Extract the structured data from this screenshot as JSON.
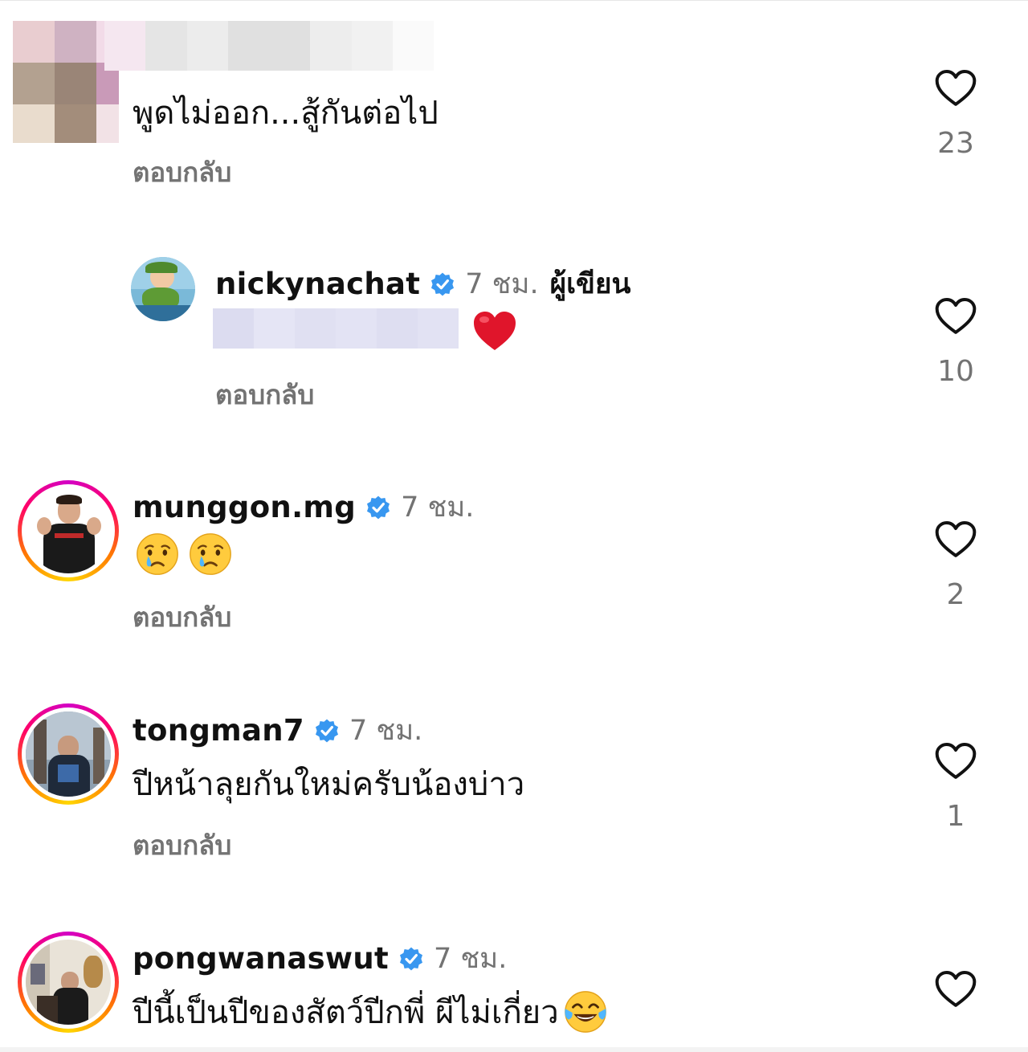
{
  "comments": [
    {
      "body": "พูดไม่ออก...สู้กันต่อไป",
      "reply_label": "ตอบกลับ",
      "likes": "23"
    },
    {
      "username": "nickynachat",
      "time": "7 ชม.",
      "author_badge": "ผู้เขียน",
      "reply_label": "ตอบกลับ",
      "likes": "10",
      "body_emoji": "red-heart"
    },
    {
      "username": "munggon.mg",
      "time": "7 ชม.",
      "reply_label": "ตอบกลับ",
      "likes": "2",
      "body_emoji": [
        "crying-face",
        "crying-face"
      ]
    },
    {
      "username": "tongman7",
      "time": "7 ชม.",
      "body": "ปีหน้าลุยกันใหม่ครับน้องบ่าว",
      "reply_label": "ตอบกลับ",
      "likes": "1"
    },
    {
      "username": "pongwanaswut",
      "time": "7 ชม.",
      "body": "ปีนี้เป็นปีของสัตว์ปีกพี่ ผีไม่เกี่ยว",
      "body_emoji": "face-with-tears-of-joy"
    }
  ],
  "colors": {
    "text": "#111111",
    "secondary": "#737373",
    "verified": "#3897f0",
    "heart_emoji": "#e0152b"
  },
  "icons": {
    "like": "heart-outline-icon",
    "verified": "verified-badge-icon"
  }
}
